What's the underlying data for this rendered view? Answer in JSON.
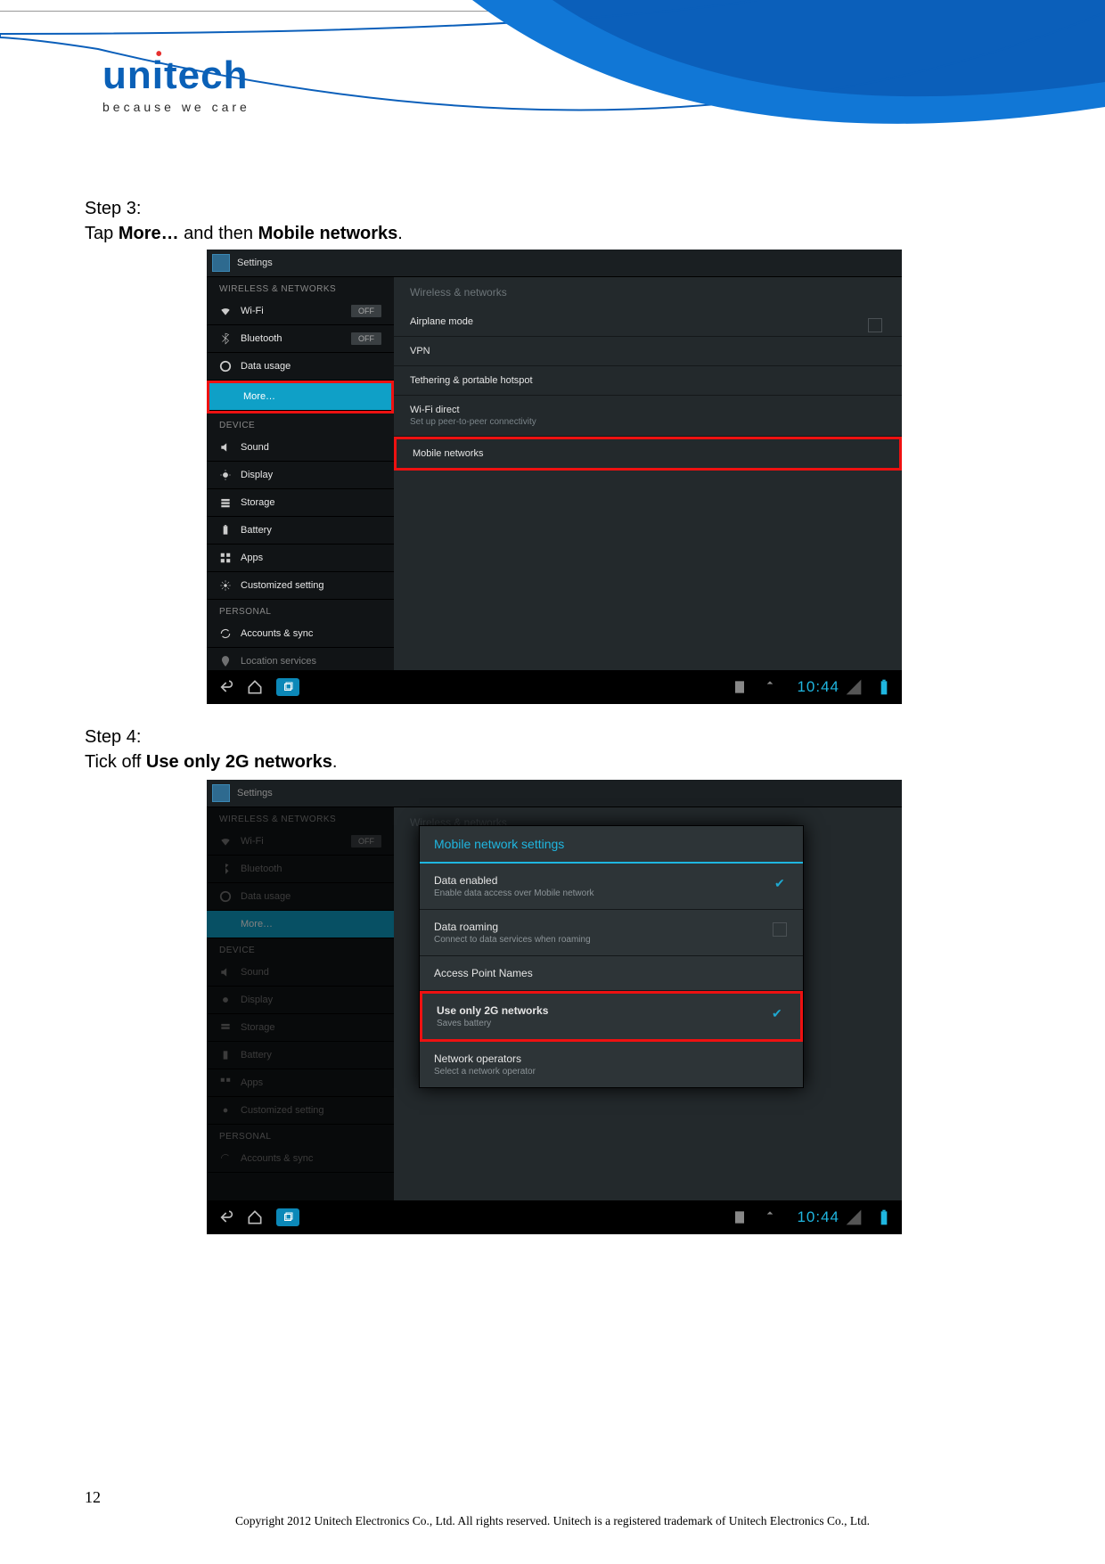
{
  "logo": {
    "brand_prefix": "un",
    "brand_i": "i",
    "brand_suffix": "tech",
    "tagline": "because we care"
  },
  "steps": {
    "s3": {
      "label": "Step 3:",
      "pre": "Tap ",
      "b1": "More…",
      "mid": " and then ",
      "b2": "Mobile networks",
      "post": "."
    },
    "s4": {
      "label": "Step 4:",
      "pre": "Tick off ",
      "b1": "Use only 2G networks",
      "post": "."
    }
  },
  "sh1": {
    "title": "Settings",
    "cat_wn": "WIRELESS & NETWORKS",
    "cat_dev": "DEVICE",
    "cat_pers": "PERSONAL",
    "off": "OFF",
    "left": {
      "wifi": "Wi-Fi",
      "bt": "Bluetooth",
      "data": "Data usage",
      "more": "More…",
      "sound": "Sound",
      "display": "Display",
      "storage": "Storage",
      "battery": "Battery",
      "apps": "Apps",
      "custom": "Customized setting",
      "accounts": "Accounts & sync",
      "location": "Location services"
    },
    "right": {
      "hdr": "Wireless & networks",
      "airplane": "Airplane mode",
      "vpn": "VPN",
      "tether": "Tethering & portable hotspot",
      "wifid": "Wi-Fi direct",
      "wifid_sub": "Set up peer-to-peer connectivity",
      "mobile": "Mobile networks"
    },
    "clock": "10:44"
  },
  "sh2": {
    "title": "Settings",
    "clock": "10:44",
    "dialog": {
      "title": "Mobile network settings",
      "de": "Data enabled",
      "de_sub": "Enable data access over Mobile network",
      "dr": "Data roaming",
      "dr_sub": "Connect to data services when roaming",
      "apn": "Access Point Names",
      "u2g": "Use only 2G networks",
      "u2g_sub": "Saves battery",
      "net": "Network operators",
      "net_sub": "Select a network operator"
    }
  },
  "footer": {
    "page": "12",
    "copy": "Copyright 2012 Unitech Electronics Co., Ltd. All rights reserved. Unitech is a registered trademark of Unitech Electronics Co., Ltd."
  }
}
